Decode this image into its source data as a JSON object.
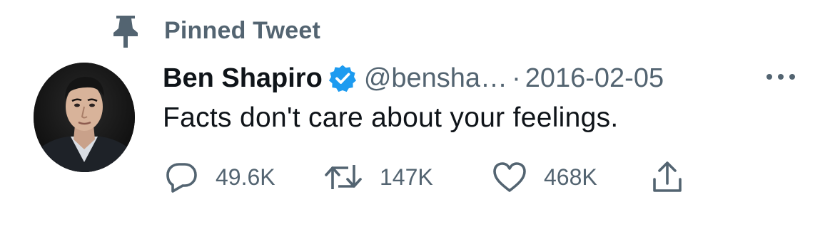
{
  "pinned": {
    "icon": "pin-icon",
    "label": "Pinned Tweet"
  },
  "author": {
    "display_name": "Ben Shapiro",
    "verified_icon": "verified-badge-icon",
    "handle": "@bensha…",
    "separator": "·",
    "date": "2016-02-05"
  },
  "tweet": {
    "text": "Facts don't care about your feelings."
  },
  "actions": {
    "reply": {
      "icon": "reply-icon",
      "count": "49.6K"
    },
    "retweet": {
      "icon": "retweet-icon",
      "count": "147K"
    },
    "like": {
      "icon": "like-icon",
      "count": "468K"
    },
    "share": {
      "icon": "share-icon"
    }
  },
  "colors": {
    "text_primary": "#0f1419",
    "text_secondary": "#536471",
    "verified_blue": "#1d9bf0",
    "background": "#ffffff"
  }
}
